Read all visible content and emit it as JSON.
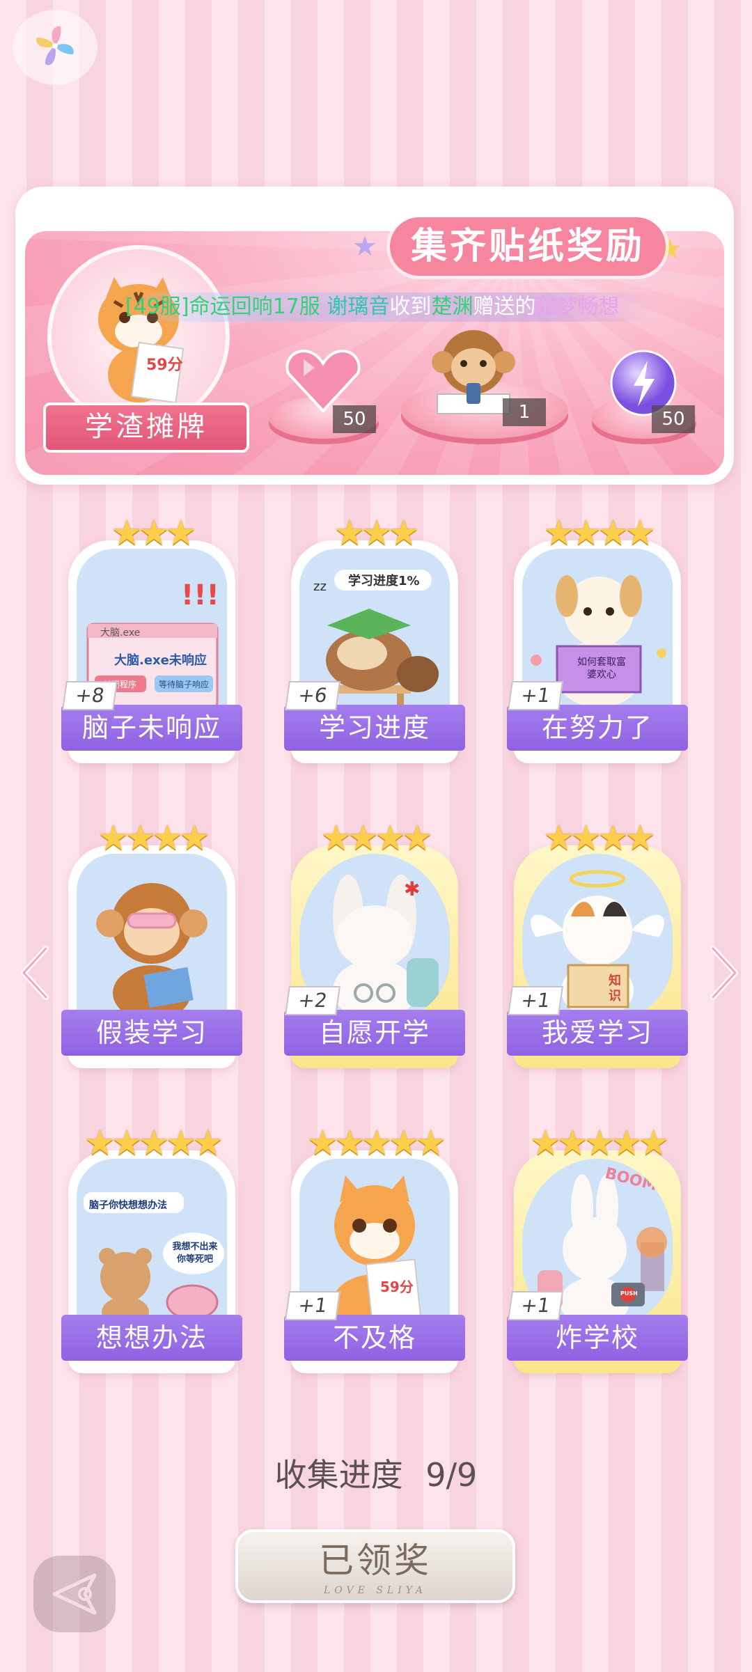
{
  "banner": {
    "title": "集齐贴纸奖励",
    "featured_label": "学渣摊牌",
    "marquee": {
      "server": "[49服]",
      "sender": "命运回响17服",
      "name": "谢璃音",
      "verb": "收到",
      "giver": "楚渊",
      "action": "赠送的",
      "gift": "甜梦畅想"
    },
    "rewards": [
      {
        "name": "pink-heart-gem",
        "count": "50"
      },
      {
        "name": "monkey-sticker",
        "count": "1"
      },
      {
        "name": "lightning-orb",
        "count": "50"
      }
    ]
  },
  "stickers": [
    {
      "label": "脑子未响应",
      "count": "+8",
      "stars": "★★★",
      "frame": "white"
    },
    {
      "label": "学习进度",
      "count": "+6",
      "stars": "★★★",
      "frame": "white"
    },
    {
      "label": "在努力了",
      "count": "+1",
      "stars": "★★★★",
      "frame": "white"
    },
    {
      "label": "假装学习",
      "count": "",
      "stars": "★★★★",
      "frame": "white"
    },
    {
      "label": "自愿开学",
      "count": "+2",
      "stars": "★★★★",
      "frame": "gold"
    },
    {
      "label": "我爱学习",
      "count": "+1",
      "stars": "★★★★",
      "frame": "gold"
    },
    {
      "label": "想想办法",
      "count": "",
      "stars": "★★★★★",
      "frame": "white"
    },
    {
      "label": "不及格",
      "count": "+1",
      "stars": "★★★★★",
      "frame": "white"
    },
    {
      "label": "炸学校",
      "count": "+1",
      "stars": "★★★★★",
      "frame": "gold"
    }
  ],
  "art_text": {
    "dialog_title": "大脑.exe",
    "dialog_msg": "大脑.exe未响应",
    "dialog_btn1": "关闭程序",
    "dialog_btn2": "等待脑子响应",
    "progress_tag": "学习进度1%",
    "book_text": "如何套取富婆欢心",
    "book2": "知识",
    "bubble1": "脑子你快想想办法",
    "bubble2": "我想不出来你等死吧",
    "paper": "59分",
    "boom": "BOOM!!",
    "push": "PUSH"
  },
  "progress": {
    "label": "收集进度",
    "value": "9/9"
  },
  "claim": {
    "label": "已领奖",
    "sub": "LOVE SLIYA"
  },
  "colors": {
    "accent": "#9a6be6",
    "banner": "#f58fab",
    "star": "#fbcf4a"
  }
}
